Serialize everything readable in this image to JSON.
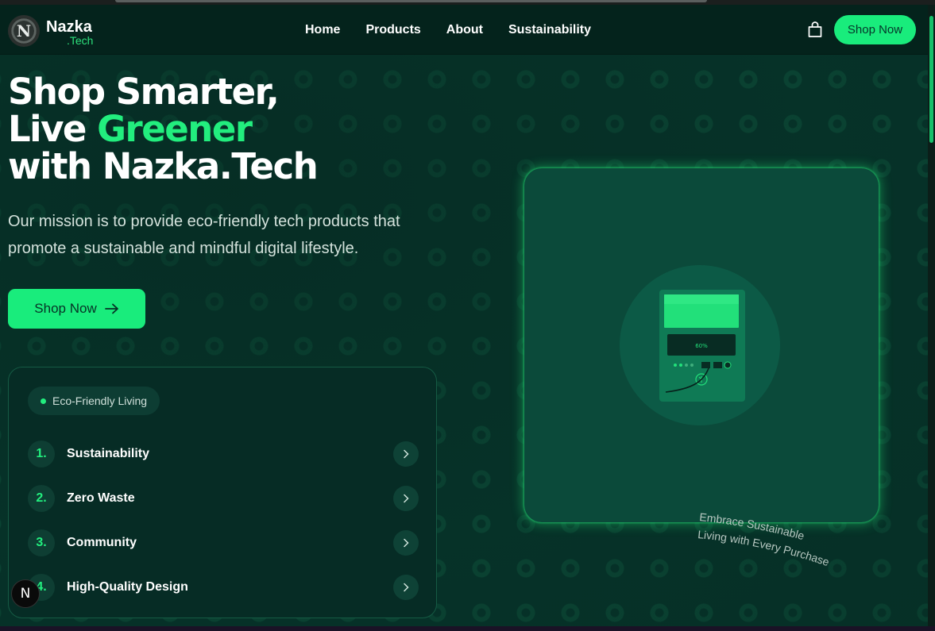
{
  "brand": {
    "name": "Nazka",
    "suffix": ".Tech",
    "badge_letter": "N",
    "accent": "#19ec7c"
  },
  "nav": {
    "links": [
      "Home",
      "Products",
      "About",
      "Sustainability"
    ],
    "cart_icon": "shopping-bag-icon",
    "shop_button": "Shop Now"
  },
  "hero": {
    "title_line1": "Shop Smarter,",
    "title_line2_prefix": "Live ",
    "title_line2_highlight": "Greener",
    "title_line3": "with Nazka.Tech",
    "description": "Our mission is to provide eco-friendly tech products that promote a sustainable and mindful digital lifestyle.",
    "button_label": "Shop Now",
    "button_icon": "arrow-right-icon"
  },
  "features": {
    "pill_label": "Eco-Friendly Living",
    "items": [
      {
        "num": "1.",
        "label": "Sustainability"
      },
      {
        "num": "2.",
        "label": "Zero Waste"
      },
      {
        "num": "3.",
        "label": "Community"
      },
      {
        "num": "4.",
        "label": "High-Quality Design"
      }
    ]
  },
  "product_card": {
    "screen_text": "60%",
    "curved_text_line1": "Embrace Sustainable",
    "curved_text_line2": "Living with Every Purchase"
  },
  "devtools_badge": "N"
}
